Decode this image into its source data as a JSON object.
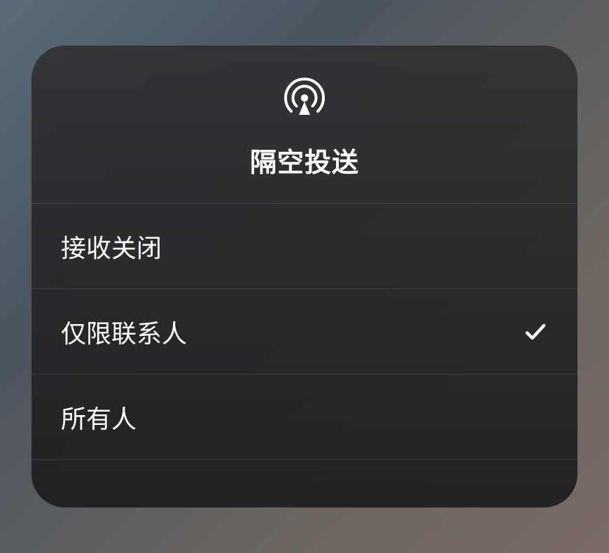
{
  "header": {
    "title": "隔空投送",
    "icon": "airdrop-icon"
  },
  "options": [
    {
      "label": "接收关闭",
      "selected": false
    },
    {
      "label": "仅限联系人",
      "selected": true
    },
    {
      "label": "所有人",
      "selected": false
    }
  ]
}
